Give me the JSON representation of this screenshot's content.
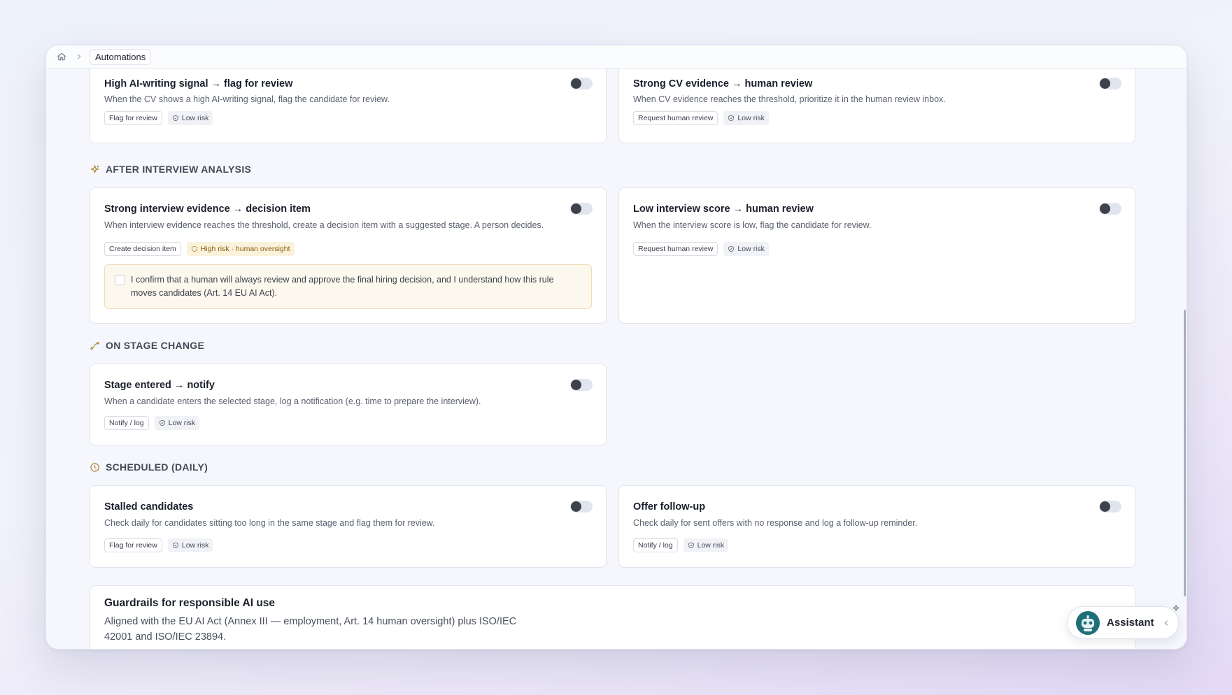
{
  "breadcrumb": {
    "current": "Automations"
  },
  "sections": {
    "after_interview": "AFTER INTERVIEW ANALYSIS",
    "stage_change": "ON STAGE CHANGE",
    "scheduled": "SCHEDULED (DAILY)"
  },
  "rules": [
    {
      "title": "High AI-writing signal → flag for review",
      "desc": "When the CV shows a high AI-writing signal, flag the candidate for review.",
      "action": "Flag for review",
      "risk": "Low risk",
      "enabled": false
    },
    {
      "title": "Strong CV evidence → human review",
      "desc": "When CV evidence reaches the threshold, prioritize it in the human review inbox.",
      "action": "Request human review",
      "risk": "Low risk",
      "enabled": false
    },
    {
      "title": "Strong interview evidence → decision item",
      "desc": "When interview evidence reaches the threshold, create a decision item with a suggested stage. A person decides.",
      "action": "Create decision item",
      "risk": "High risk · human oversight",
      "enabled": false,
      "confirm": "I confirm that a human will always review and approve the final hiring decision, and I understand how this rule moves candidates (Art. 14 EU AI Act)."
    },
    {
      "title": "Low interview score → human review",
      "desc": "When the interview score is low, flag the candidate for review.",
      "action": "Request human review",
      "risk": "Low risk",
      "enabled": false
    },
    {
      "title": "Stage entered → notify",
      "desc": "When a candidate enters the selected stage, log a notification (e.g. time to prepare the interview).",
      "action": "Notify / log",
      "risk": "Low risk",
      "enabled": false
    },
    {
      "title": "Stalled candidates",
      "desc": "Check daily for candidates sitting too long in the same stage and flag them for review.",
      "action": "Flag for review",
      "risk": "Low risk",
      "enabled": false
    },
    {
      "title": "Offer follow-up",
      "desc": "Check daily for sent offers with no response and log a follow-up reminder.",
      "action": "Notify / log",
      "risk": "Low risk",
      "enabled": false
    }
  ],
  "guardrails": {
    "title": "Guardrails for responsible AI use",
    "desc": "Aligned with the EU AI Act (Annex III — employment, Art. 14 human oversight) plus ISO/IEC 42001 and ISO/IEC 23894."
  },
  "assistant": {
    "label": "Assistant"
  },
  "colors": {
    "accent_icon": "#b08a3e",
    "high_risk_bg": "#fbf2dc",
    "toggle_off": "#e1e5ee"
  }
}
